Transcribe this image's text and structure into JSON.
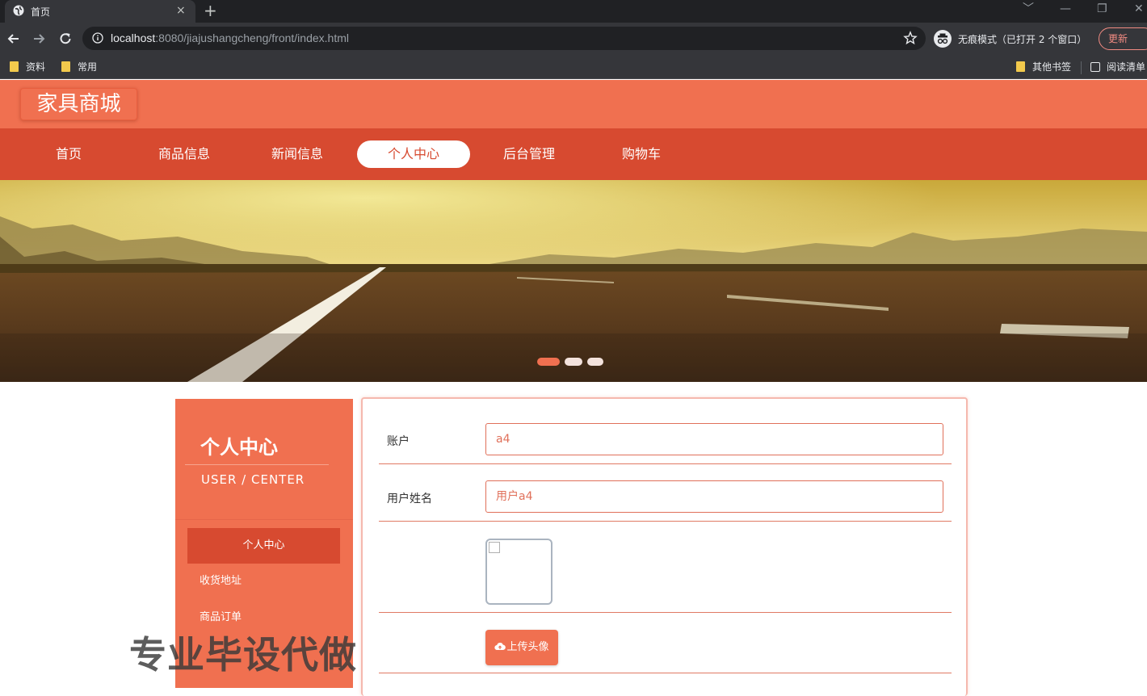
{
  "browser": {
    "tab_title": "首页",
    "tab_close": "×",
    "new_tab": "+",
    "url_host": "localhost",
    "url_rest": ":8080/jiajushangcheng/front/index.html",
    "incognito_label": "无痕模式（已打开 2 个窗口）",
    "update_label": "更新",
    "window_controls": [
      "﹀",
      "—",
      "❐",
      "✕"
    ],
    "bookmarks_left": [
      "资料",
      "常用"
    ],
    "bookmarks_right": [
      "其他书签",
      "阅读清单"
    ]
  },
  "site": {
    "logo": "家具商城",
    "nav": [
      {
        "label": "首页"
      },
      {
        "label": "商品信息"
      },
      {
        "label": "新闻信息"
      },
      {
        "label": "个人中心",
        "active": true
      },
      {
        "label": "后台管理"
      },
      {
        "label": "购物车"
      }
    ]
  },
  "banner": {
    "slide_count": 3,
    "active_slide": 1
  },
  "sidebar": {
    "title": "个人中心",
    "subtitle": "USER / CENTER",
    "items": [
      {
        "label": "个人中心",
        "active": true
      },
      {
        "label": "收货地址"
      },
      {
        "label": "商品订单"
      }
    ]
  },
  "form": {
    "account_label": "账户",
    "account_value": "a4",
    "name_label": "用户姓名",
    "name_value": "用户a4",
    "upload_label": "上传头像"
  },
  "watermark": "专业毕设代做",
  "colors": {
    "header": "#f07050",
    "nav": "#d74a30",
    "accent": "#e0705a"
  }
}
